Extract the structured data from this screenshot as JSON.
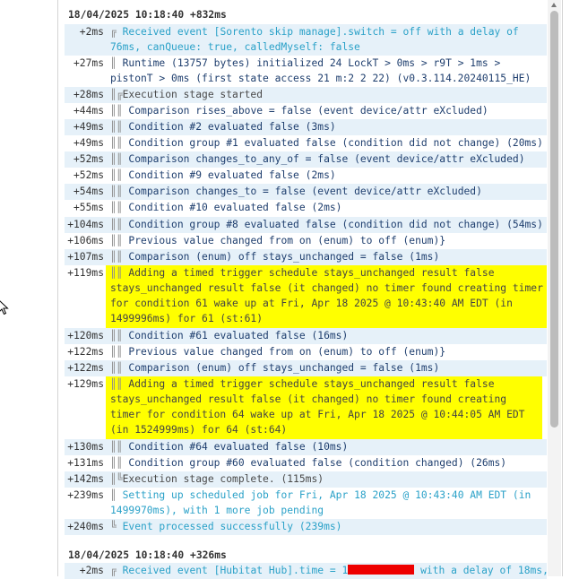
{
  "log": {
    "header1": "18/04/2025 10:18:40 +832ms",
    "header2": "18/04/2025 10:18:40 +326ms",
    "entries": [
      {
        "t": "+2ms",
        "p": "╔",
        "m": "Received event [Sorento skip manage].switch = off with a delay of 76ms, canQueue: true, calledMyself: false"
      },
      {
        "t": "+27ms",
        "p": "║",
        "m": "Runtime (13757 bytes) initialized 24 LockT > 0ms > r9T > 1ms > pistonT > 0ms (first state access 21 m:2 2 22) (v0.3.114.20240115_HE)"
      },
      {
        "t": "+28ms",
        "p": "║╔",
        "m": "Execution stage started"
      },
      {
        "t": "+44ms",
        "p": "║║",
        "m": "Comparison rises_above = false (event device/attr eXcluded)"
      },
      {
        "t": "+49ms",
        "p": "║║",
        "m": "Condition #2 evaluated false (3ms)"
      },
      {
        "t": "+49ms",
        "p": "║║",
        "m": "Condition group #1 evaluated false (condition did not change) (20ms)"
      },
      {
        "t": "+52ms",
        "p": "║║",
        "m": "Comparison changes_to_any_of = false (event device/attr eXcluded)"
      },
      {
        "t": "+52ms",
        "p": "║║",
        "m": "Condition #9 evaluated false (2ms)"
      },
      {
        "t": "+54ms",
        "p": "║║",
        "m": "Comparison changes_to = false (event device/attr eXcluded)"
      },
      {
        "t": "+55ms",
        "p": "║║",
        "m": "Condition #10 evaluated false (2ms)"
      },
      {
        "t": "+104ms",
        "p": "║║",
        "m": "Condition group #8 evaluated false (condition did not change) (54ms)"
      },
      {
        "t": "+106ms",
        "p": "║║",
        "m": "Previous value changed from on (enum) to off (enum)}"
      },
      {
        "t": "+107ms",
        "p": "║║",
        "m": "Comparison (enum) off stays_unchanged = false (1ms)"
      },
      {
        "t": "+119ms",
        "p": "║║",
        "m": "Adding a timed trigger schedule stays_unchanged result false stays_unchanged result false (it changed) no timer found creating timer for condition 61 wake up at Fri, Apr 18 2025 @ 10:43:40 AM EDT (in 1499996ms) for 61 (st:61)"
      },
      {
        "t": "+120ms",
        "p": "║║",
        "m": "Condition #61 evaluated false (16ms)"
      },
      {
        "t": "+122ms",
        "p": "║║",
        "m": "Previous value changed from on (enum) to off (enum)}"
      },
      {
        "t": "+122ms",
        "p": "║║",
        "m": "Comparison (enum) off stays_unchanged = false (1ms)"
      },
      {
        "t": "+129ms",
        "p": "║║",
        "m": "Adding a timed trigger schedule stays_unchanged result false stays_unchanged result false (it changed) no timer found creating timer for condition 64 wake up at Fri, Apr 18 2025 @ 10:44:05 AM EDT (in 1524999ms) for 64 (st:64)"
      },
      {
        "t": "+130ms",
        "p": "║║",
        "m": "Condition #64 evaluated false (10ms)"
      },
      {
        "t": "+131ms",
        "p": "║║",
        "m": "Condition group #60 evaluated false (condition changed) (26ms)"
      },
      {
        "t": "+142ms",
        "p": "║╚",
        "m": "Execution stage complete. (115ms)"
      },
      {
        "t": "+239ms",
        "p": "║",
        "m": "Setting up scheduled job for Fri, Apr 18 2025 @ 10:43:40 AM EDT (in 1499970ms), with 1 more job pending"
      },
      {
        "t": "+240ms",
        "p": "╚",
        "m": "Event processed successfully (239ms)"
      },
      {
        "t": "+2ms",
        "p": "╔",
        "m": "Received event [Hubitat Hub].time = 1",
        "m2": " with a delay of 18ms,"
      }
    ]
  },
  "colors": {
    "cyan": "#2aa1c8",
    "navy": "#1e3e6e",
    "highlight": "#ffff00",
    "row_alt": "#e6f1f9",
    "redaction": "#ee0000"
  }
}
